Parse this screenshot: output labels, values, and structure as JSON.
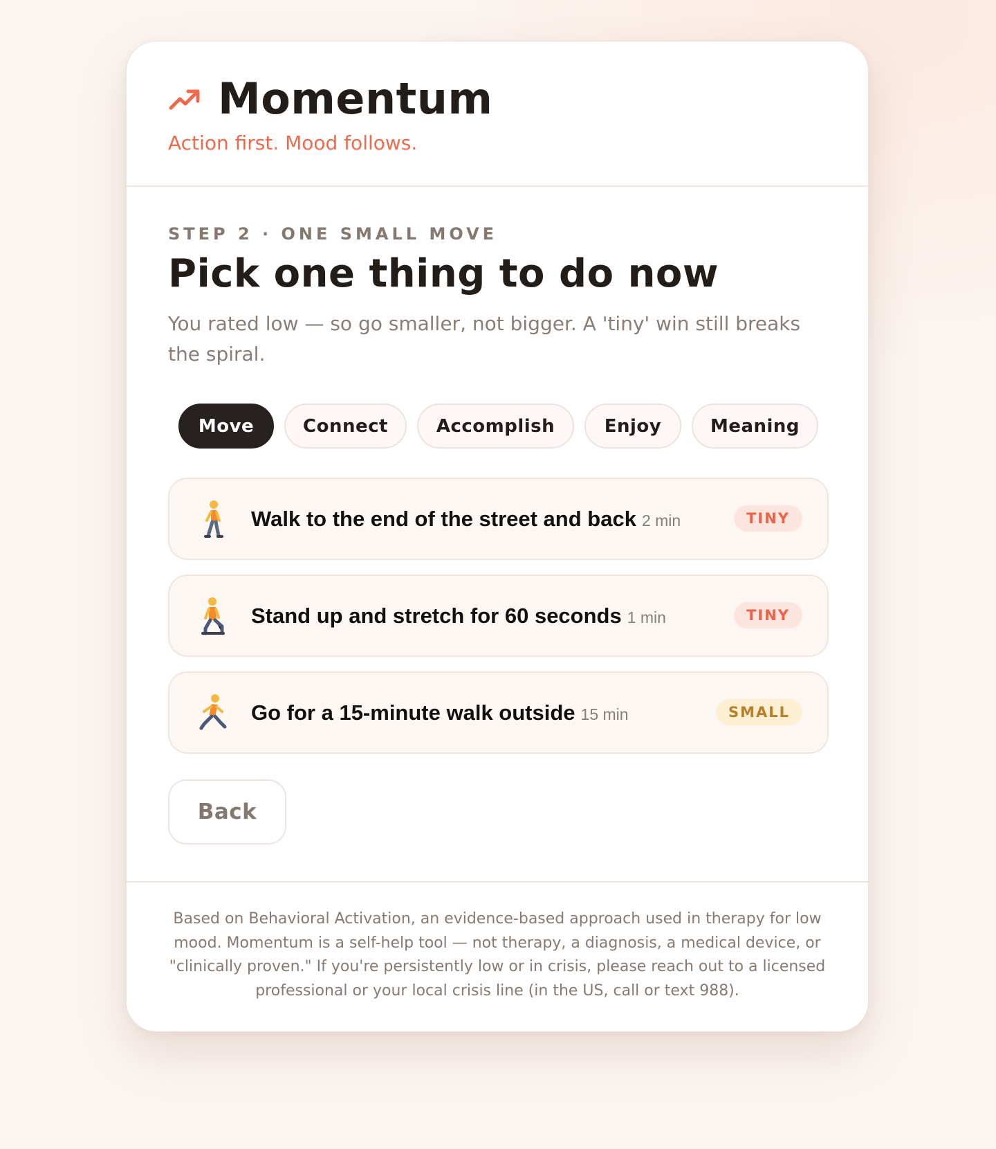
{
  "app": {
    "title": "Momentum",
    "tagline": "Action first. Mood follows.",
    "logo_icon": "trending-up-icon",
    "accent_color": "#ef6a4c"
  },
  "step": {
    "label": "STEP 2 · ONE SMALL MOVE",
    "title": "Pick one thing to do now",
    "subtitle": "You rated low — so go smaller, not bigger. A 'tiny' win still breaks the spiral."
  },
  "tabs": [
    {
      "label": "Move",
      "active": true
    },
    {
      "label": "Connect",
      "active": false
    },
    {
      "label": "Accomplish",
      "active": false
    },
    {
      "label": "Enjoy",
      "active": false
    },
    {
      "label": "Meaning",
      "active": false
    }
  ],
  "activities": [
    {
      "icon": "walking-person-icon",
      "title": "Walk to the end of the street and back",
      "duration": "2 min",
      "size": "TINY"
    },
    {
      "icon": "kneeling-person-icon",
      "title": "Stand up and stretch for 60 seconds",
      "duration": "1 min",
      "size": "TINY"
    },
    {
      "icon": "running-person-icon",
      "title": "Go for a 15-minute walk outside",
      "duration": "15 min",
      "size": "SMALL"
    }
  ],
  "actions": {
    "back_label": "Back"
  },
  "footer": {
    "disclaimer": "Based on Behavioral Activation, an evidence-based approach used in therapy for low mood. Momentum is a self-help tool — not therapy, a diagnosis, a medical device, or \"clinically proven.\" If you're persistently low or in crisis, please reach out to a licensed professional or your local crisis line (in the US, call or text 988)."
  },
  "colors": {
    "tiny_badge": "#ee6247",
    "small_badge": "#b8802a",
    "active_tab": "#272120"
  }
}
